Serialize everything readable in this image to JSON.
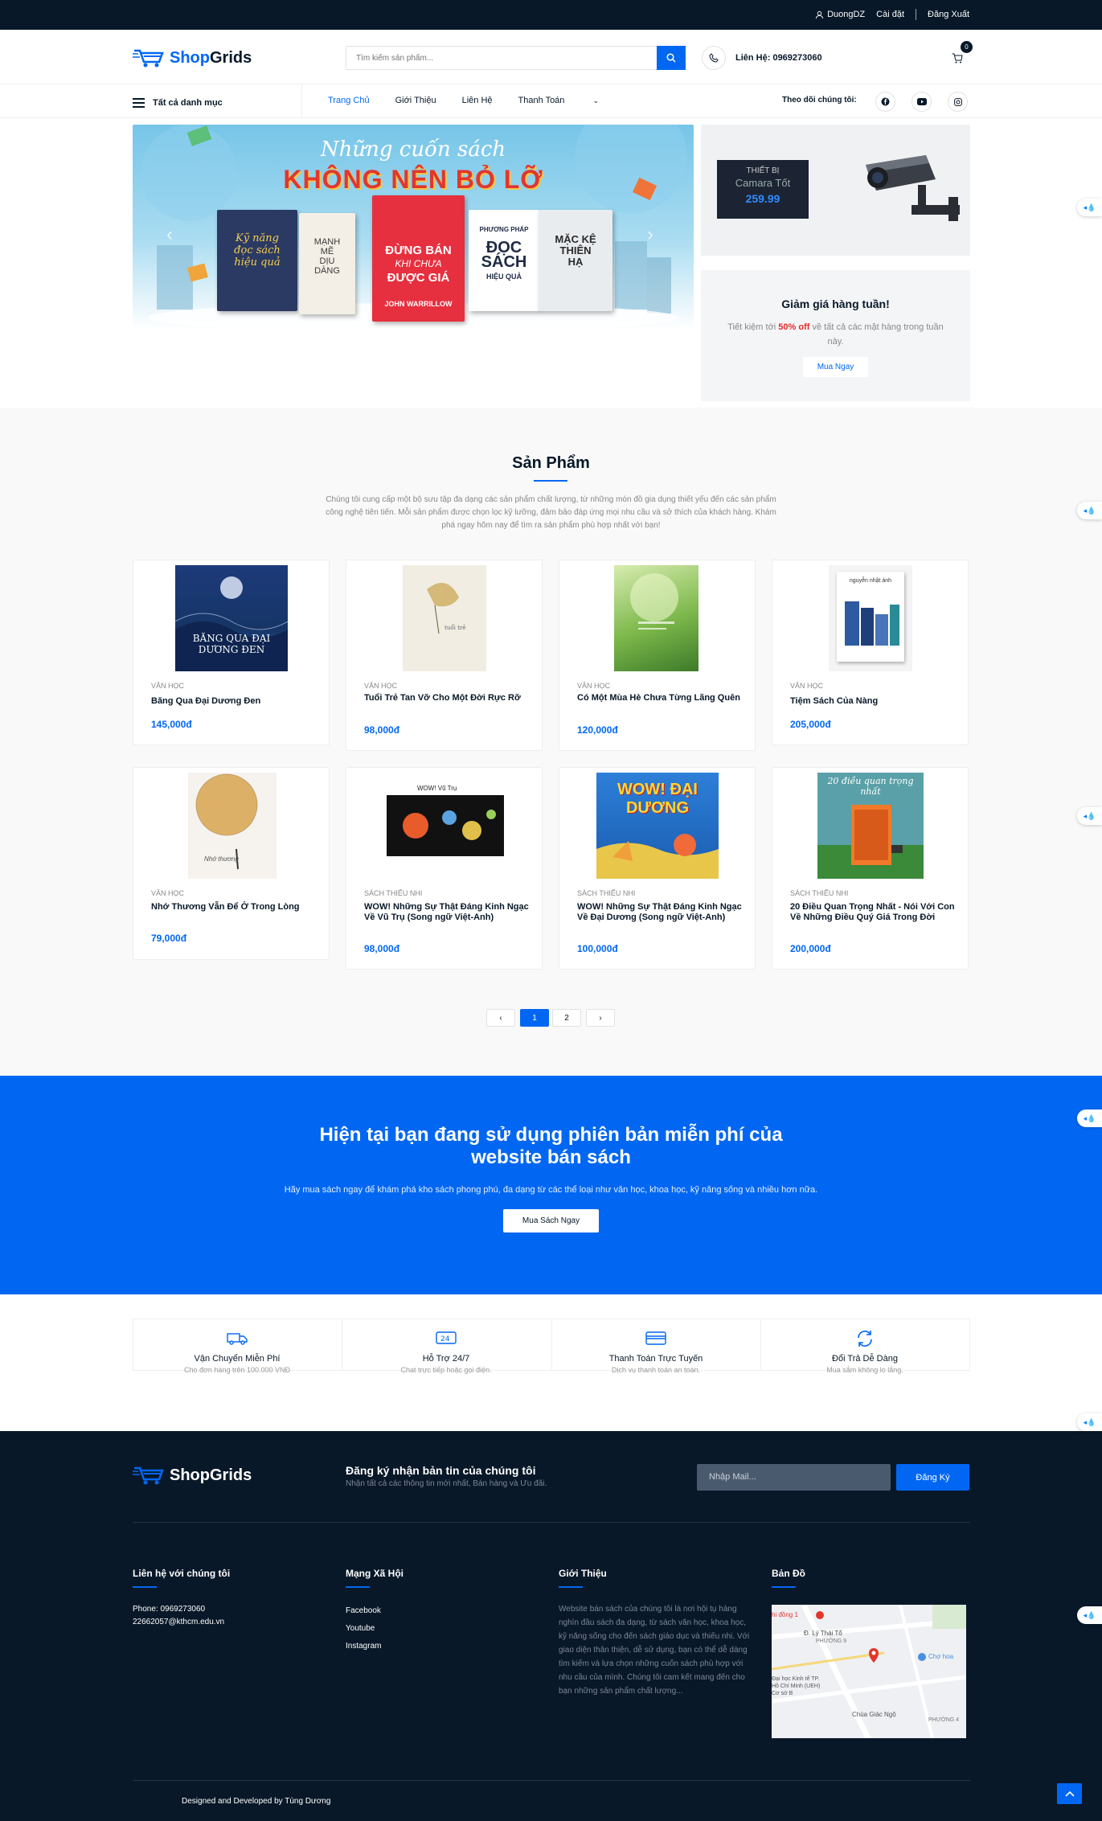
{
  "topbar": {
    "user": "DuongDZ",
    "settings": "Cài đặt",
    "logout": "Đăng Xuất"
  },
  "header": {
    "logo": {
      "part1": "Shop",
      "part2": "Grids"
    },
    "search_placeholder": "Tìm kiếm sản phẩm...",
    "hotline": "Liên Hệ: 0969273060",
    "cart_count": "0"
  },
  "nav": {
    "all_categories": "Tất cả danh mục",
    "menu": [
      "Trang Chủ",
      "Giới Thiệu",
      "Liên Hệ",
      "Thanh Toán"
    ],
    "follow": "Theo dõi chúng tôi:"
  },
  "hero": {
    "subtitle": "Những cuốn sách",
    "title": "KHÔNG NÊN BỎ LỠ",
    "books": [
      {
        "lines": [
          "Kỹ năng",
          "đọc sách",
          "hiệu quả"
        ],
        "color": "#2b3a63",
        "text": "#f7d04b"
      },
      {
        "lines": [
          "MẠNH",
          "MẼ",
          "DỊU",
          "DÀNG"
        ],
        "color": "#f4efe6",
        "text": "#3a3a3a"
      },
      {
        "lines": [
          "ĐỪNG BÁN",
          "KHI CHƯA",
          "ĐƯỢC GIÁ",
          "JOHN WARRILLOW"
        ],
        "color": "#e6303f",
        "text": "#ffffff"
      },
      {
        "lines": [
          "PHƯƠNG PHÁP",
          "ĐỌC",
          "SÁCH",
          "HIỆU QUẢ"
        ],
        "color": "#ffffff",
        "text": "#1f2a44"
      },
      {
        "lines": [
          "MẶC KỆ",
          "THIÊN",
          "HẠ"
        ],
        "color": "#e9ecef",
        "text": "#2b2b2b"
      }
    ]
  },
  "promo": {
    "label_small": "THIẾT BỊ",
    "label_name": "Camara Tốt",
    "price": "259.99",
    "weekly_title": "Giảm giá hàng tuần!",
    "weekly_text_before": "Tiết kiệm tới ",
    "weekly_highlight": "50% off",
    "weekly_text_after": " về tất cả các mặt hàng trong tuần này.",
    "weekly_button": "Mua Ngay"
  },
  "products": {
    "title": "Sản Phẩm",
    "description": "Chúng tôi cung cấp một bộ sưu tập đa dạng các sản phẩm chất lượng, từ những món đồ gia dụng thiết yếu đến các sản phẩm công nghệ tiên tiến. Mỗi sản phẩm được chọn lọc kỹ lưỡng, đảm bảo đáp ứng mọi nhu cầu và sở thích của khách hàng. Khám phá ngay hôm nay để tìm ra sản phẩm phù hợp nhất với bạn!",
    "items": [
      {
        "category": "VĂN HỌC",
        "name": "Băng Qua Đại Dương Đen",
        "price": "145,000đ"
      },
      {
        "category": "VĂN HỌC",
        "name": "Tuổi Trẻ Tan Vỡ Cho Một Đời Rực Rỡ",
        "price": "98,000đ"
      },
      {
        "category": "VĂN HỌC",
        "name": "Có Một Mùa Hè Chưa Từng Lãng Quên",
        "price": "120,000đ"
      },
      {
        "category": "VĂN HỌC",
        "name": "Tiệm Sách Của Nàng",
        "price": "205,000đ"
      },
      {
        "category": "VĂN HỌC",
        "name": "Nhớ Thương Vẫn Để Ở Trong Lòng",
        "price": "79,000đ"
      },
      {
        "category": "SÁCH THIẾU NHI",
        "name": "WOW! Những Sự Thật Đáng Kinh Ngạc Về Vũ Trụ (Song ngữ Việt-Anh)",
        "price": "98,000đ"
      },
      {
        "category": "SÁCH THIẾU NHI",
        "name": "WOW! Những Sự Thật Đáng Kinh Ngạc Về Đại Dương (Song ngữ Việt-Anh)",
        "price": "100,000đ"
      },
      {
        "category": "SÁCH THIẾU NHI",
        "name": "20 Điều Quan Trọng Nhất - Nói Với Con Về Những Điều Quý Giá Trong Đời",
        "price": "200,000đ"
      }
    ],
    "cover_texts": [
      "BĂNG QUA ĐẠI DƯƠNG ĐEN",
      "",
      "",
      "nguyễn nhật ánh",
      "",
      "",
      "WOW! ĐẠI DƯƠNG",
      "20 điều quan trọng nhất"
    ],
    "pages": [
      "1",
      "2"
    ],
    "prev": "‹",
    "next": "›"
  },
  "cta": {
    "title": "Hiện tại bạn đang sử dụng phiên bản miễn phí của website bán sách",
    "text": "Hãy mua sách ngay để khám phá kho sách phong phú, đa dạng từ các thể loại như văn học, khoa học, kỹ năng sống và nhiều hơn nữa.",
    "button": "Mua Sách Ngay"
  },
  "features": [
    {
      "title": "Vận Chuyển Miễn Phí",
      "subtitle": "Cho đơn hàng trên 100.000 VNĐ",
      "icon": "truck-icon"
    },
    {
      "title": "Hỗ Trợ 24/7",
      "subtitle": "Chat trực tiếp hoặc gọi điện.",
      "icon": "support-icon"
    },
    {
      "title": "Thanh Toán Trực Tuyến",
      "subtitle": "Dịch vụ thanh toán an toàn.",
      "icon": "card-icon"
    },
    {
      "title": "Đổi Trả Dễ Dàng",
      "subtitle": "Mua sắm không lo lắng.",
      "icon": "refresh-icon"
    }
  ],
  "footer": {
    "newsletter_title": "Đăng ký nhận bản tin của chúng tôi",
    "newsletter_sub": "Nhận tất cả các thông tin mới nhất, Bán hàng và Ưu đãi.",
    "newsletter_placeholder": "Nhập Mail...",
    "newsletter_button": "Đăng Ký",
    "contact_title": "Liên hệ với chúng tôi",
    "phone": "Phone: 0969273060",
    "email": "22662057@kthcm.edu.vn",
    "social_title": "Mạng Xã Hội",
    "social": [
      "Facebook",
      "Youtube",
      "Instagram"
    ],
    "about_title": "Giới Thiệu",
    "about_text": "Website bán sách của chúng tôi là nơi hội tụ hàng nghìn đầu sách đa dạng, từ sách văn học, khoa học, kỹ năng sống cho đến sách giáo dục và thiếu nhi. Với giao diện thân thiện, dễ sử dụng, bạn có thể dễ dàng tìm kiếm và lựa chọn những cuốn sách phù hợp với nhu cầu của mình. Chúng tôi cam kết mang đến cho bạn những sản phẩm chất lượng...",
    "map_title": "Bản Đồ",
    "map_labels": [
      "hi đồng 1",
      "Đ. Lý Thái Tổ",
      "PHƯỜNG 9",
      "Chợ hoa",
      "Đại học Kinh tế TP. Hồ Chí Minh (UEH) Cơ sở B",
      "Chùa Giác Ngộ",
      "PHƯỜNG 4"
    ],
    "credit": "Designed and Developed by Tùng Dương"
  },
  "colors": {
    "primary": "#0167f3",
    "dark": "#081828",
    "sale": "#e22d2d"
  }
}
